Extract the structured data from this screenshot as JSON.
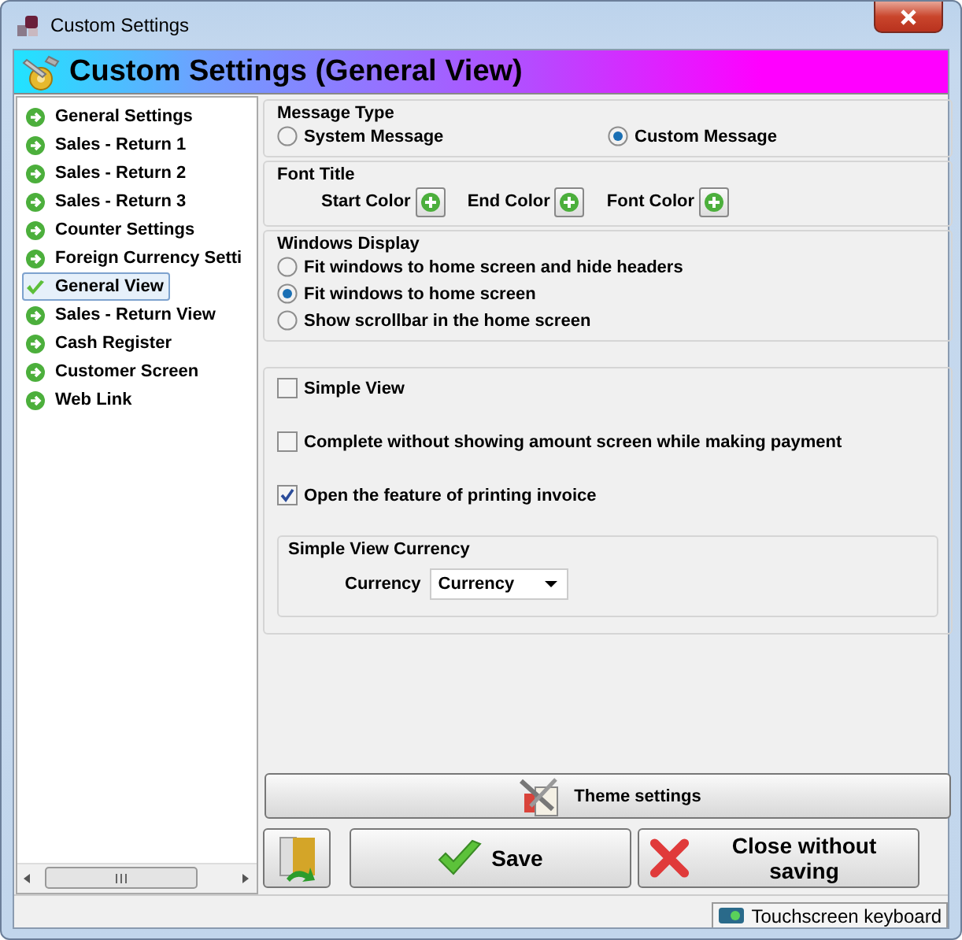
{
  "window": {
    "title": "Custom Settings"
  },
  "banner": {
    "title": "Custom Settings (General View)"
  },
  "sidebar": {
    "items": [
      {
        "label": "General Settings",
        "selected": false
      },
      {
        "label": "Sales - Return 1",
        "selected": false
      },
      {
        "label": "Sales - Return 2",
        "selected": false
      },
      {
        "label": "Sales - Return 3",
        "selected": false
      },
      {
        "label": "Counter Settings",
        "selected": false
      },
      {
        "label": "Foreign Currency Setti",
        "selected": false
      },
      {
        "label": "General View",
        "selected": true
      },
      {
        "label": "Sales - Return View",
        "selected": false
      },
      {
        "label": "Cash Register",
        "selected": false
      },
      {
        "label": "Customer Screen",
        "selected": false
      },
      {
        "label": "Web Link",
        "selected": false
      }
    ]
  },
  "message_type": {
    "title": "Message Type",
    "options": [
      {
        "label": "System Message",
        "selected": false
      },
      {
        "label": "Custom Message",
        "selected": true
      }
    ]
  },
  "font_title": {
    "title": "Font Title",
    "colors": [
      {
        "label": "Start Color"
      },
      {
        "label": "End Color"
      },
      {
        "label": "Font Color"
      }
    ]
  },
  "windows_display": {
    "title": "Windows Display",
    "options": [
      {
        "label": "Fit windows to home screen and hide headers",
        "selected": false
      },
      {
        "label": "Fit windows to home screen",
        "selected": true
      },
      {
        "label": "Show scrollbar in the home screen",
        "selected": false
      }
    ]
  },
  "options": [
    {
      "label": "Simple View",
      "checked": false
    },
    {
      "label": "Complete without showing amount screen while making payment",
      "checked": false
    },
    {
      "label": "Open the feature of printing invoice",
      "checked": true
    }
  ],
  "currency_group": {
    "title": "Simple View Currency",
    "label": "Currency",
    "value": "Currency"
  },
  "theme_button": {
    "label": "Theme settings"
  },
  "buttons": [
    {
      "kind": "save",
      "label": "Save"
    },
    {
      "kind": "close",
      "label": "Close without saving"
    }
  ],
  "status_bar": {
    "keyboard": "Touchscreen keyboard"
  }
}
